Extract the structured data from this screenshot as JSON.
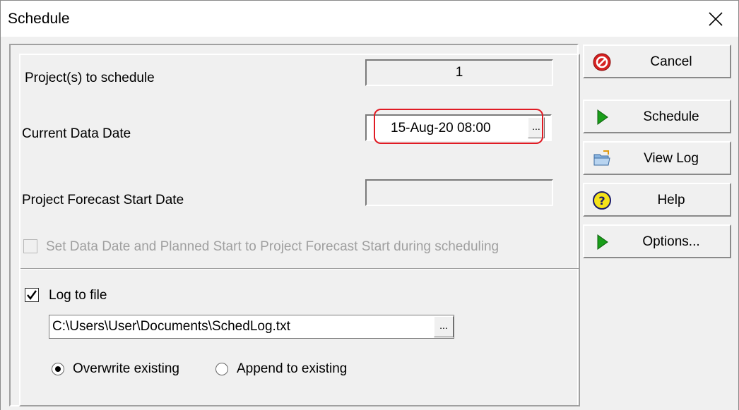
{
  "window": {
    "title": "Schedule"
  },
  "form": {
    "projects_label": "Project(s) to schedule",
    "projects_value": "1",
    "data_date_label": "Current Data Date",
    "data_date_value": "15-Aug-20 08:00",
    "data_date_browse": "...",
    "forecast_label": "Project Forecast Start Date",
    "forecast_value": "",
    "set_data_date_checkbox_label": "Set Data Date and Planned Start to Project Forecast Start during scheduling",
    "set_data_date_checked": false,
    "log_to_file_label": "Log to file",
    "log_to_file_checked": true,
    "log_path": "C:\\Users\\User\\Documents\\SchedLog.txt",
    "log_path_browse": "...",
    "overwrite_label": "Overwrite existing",
    "append_label": "Append to existing",
    "selected_mode": "overwrite"
  },
  "buttons": {
    "cancel": {
      "label": "Cancel",
      "icon": "cancel-icon"
    },
    "schedule": {
      "label": "Schedule",
      "icon": "play-icon"
    },
    "view_log": {
      "label": "View Log",
      "icon": "folder-icon"
    },
    "help": {
      "label": "Help",
      "icon": "help-icon"
    },
    "options": {
      "label": "Options...",
      "icon": "play-icon"
    }
  },
  "colors": {
    "dialog_bg": "#f0f0f0",
    "highlight": "#e01b24",
    "play_green": "#1a9e1a",
    "cancel_red": "#d62020",
    "help_yellow": "#f4e21a"
  }
}
